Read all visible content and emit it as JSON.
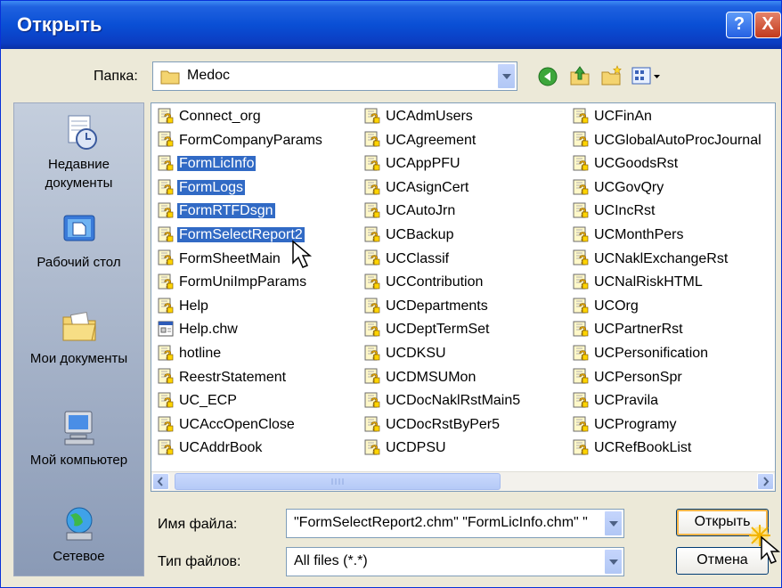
{
  "window": {
    "title": "Открыть",
    "help_label": "?",
    "close_label": "X"
  },
  "toolbar": {
    "folder_label": "Папка:",
    "folder_value": "Medoc",
    "icons": [
      "back-icon",
      "up-folder-icon",
      "new-folder-icon",
      "view-menu-icon"
    ]
  },
  "places": [
    {
      "label": "Недавние документы",
      "icon": "recent-documents-icon"
    },
    {
      "label": "Рабочий стол",
      "icon": "desktop-icon"
    },
    {
      "label": "Мои документы",
      "icon": "my-documents-icon"
    },
    {
      "label": "Мой компьютер",
      "icon": "my-computer-icon"
    },
    {
      "label": "Сетевое",
      "icon": "network-icon"
    }
  ],
  "files": {
    "col1": [
      "Connect_org",
      "FormCompanyParams",
      "FormLicInfo",
      "FormLogs",
      "FormRTFDsgn",
      "FormSelectReport2",
      "FormSheetMain",
      "FormUniImpParams",
      "Help",
      "Help.chw",
      "hotline",
      "ReestrStatement",
      "UC_ECP",
      "UCAccOpenClose",
      "UCAddrBook"
    ],
    "col2": [
      "UCAdmUsers",
      "UCAgreement",
      "UCAppPFU",
      "UCAsignCert",
      "UCAutoJrn",
      "UCBackup",
      "UCClassif",
      "UCContribution",
      "UCDepartments",
      "UCDeptTermSet",
      "UCDKSU",
      "UCDMSUMon",
      "UCDocNaklRstMain5",
      "UCDocRstByPer5",
      "UCDPSU"
    ],
    "col3": [
      "UCFinAn",
      "UCGlobalAutoProcJournal",
      "UCGoodsRst",
      "UCGovQry",
      "UCIncRst",
      "UCMonthPers",
      "UCNaklExchangeRst",
      "UCNalRiskHTML",
      "UCOrg",
      "UCPartnerRst",
      "UCPersonification",
      "UCPersonSpr",
      "UCPravila",
      "UCProgramy",
      "UCRefBookList"
    ],
    "selected": [
      "FormLicInfo",
      "FormLogs",
      "FormRTFDsgn",
      "FormSelectReport2"
    ]
  },
  "filename": {
    "label": "Имя файла:",
    "value": "\"FormSelectReport2.chm\" \"FormLicInfo.chm\" \""
  },
  "filetype": {
    "label": "Тип файлов:",
    "value": "All files (*.*)"
  },
  "buttons": {
    "open": "Открыть",
    "cancel": "Отмена"
  },
  "colors": {
    "title_bar": "#0A4FD5",
    "selection": "#316AC5",
    "dialog_bg": "#ECE9D8"
  }
}
